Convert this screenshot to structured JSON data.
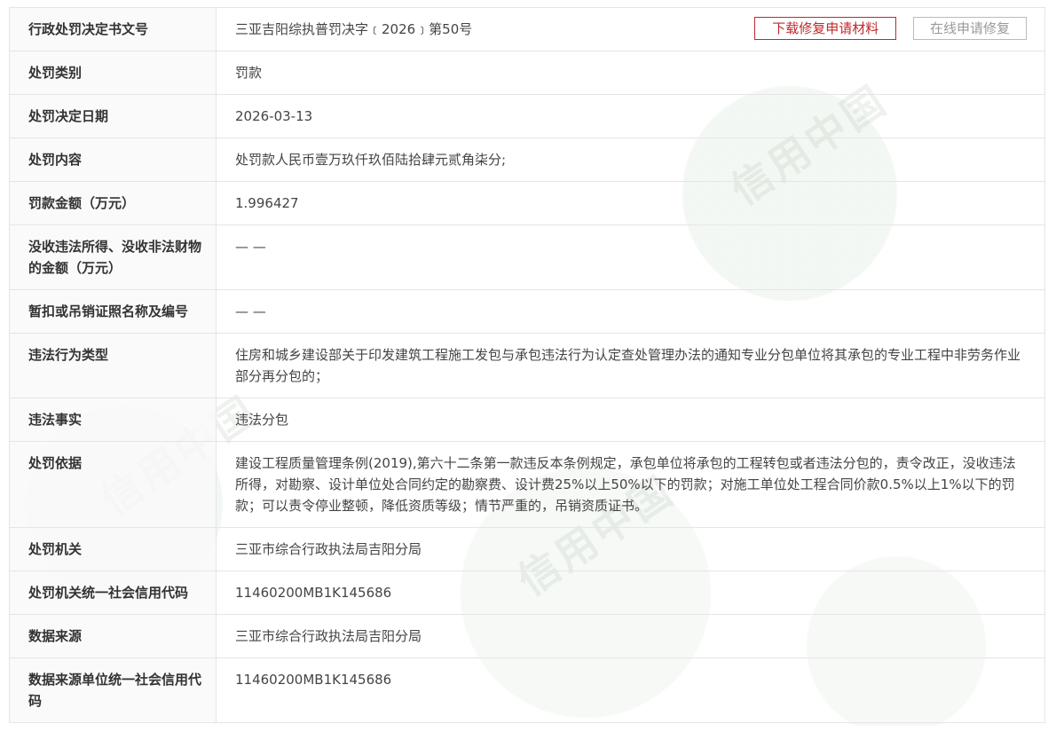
{
  "rows": [
    {
      "label": "行政处罚决定书文号",
      "value": "三亚吉阳综执普罚决字﹝2026﹞第50号"
    },
    {
      "label": "处罚类别",
      "value": "罚款"
    },
    {
      "label": "处罚决定日期",
      "value": "2026-03-13"
    },
    {
      "label": "处罚内容",
      "value": "处罚款人民币壹万玖仟玖佰陆拾肆元贰角柒分;"
    },
    {
      "label": "罚款金额（万元）",
      "value": "1.996427"
    },
    {
      "label": "没收违法所得、没收非法财物的金额（万元）",
      "value": "— —"
    },
    {
      "label": "暂扣或吊销证照名称及编号",
      "value": "— —"
    },
    {
      "label": "违法行为类型",
      "value": "住房和城乡建设部关于印发建筑工程施工发包与承包违法行为认定查处管理办法的通知专业分包单位将其承包的专业工程中非劳务作业部分再分包的；"
    },
    {
      "label": "违法事实",
      "value": "违法分包"
    },
    {
      "label": "处罚依据",
      "value": "建设工程质量管理条例(2019),第六十二条第一款违反本条例规定，承包单位将承包的工程转包或者违法分包的，责令改正，没收违法所得，对勘察、设计单位处合同约定的勘察费、设计费25%以上50%以下的罚款；对施工单位处工程合同价款0.5%以上1%以下的罚款；可以责令停业整顿，降低资质等级；情节严重的，吊销资质证书。"
    },
    {
      "label": "处罚机关",
      "value": "三亚市综合行政执法局吉阳分局"
    },
    {
      "label": "处罚机关统一社会信用代码",
      "value": "11460200MB1K145686"
    },
    {
      "label": "数据来源",
      "value": "三亚市综合行政执法局吉阳分局"
    },
    {
      "label": "数据来源单位统一社会信用代码",
      "value": "11460200MB1K145686"
    }
  ],
  "buttons": {
    "download": "下载修复申请材料",
    "online": "在线申请修复"
  },
  "watermark": "信用中国",
  "colors": {
    "accent": "#c0282d",
    "disabled": "#9a9a9a",
    "border": "#e5e5e5"
  }
}
